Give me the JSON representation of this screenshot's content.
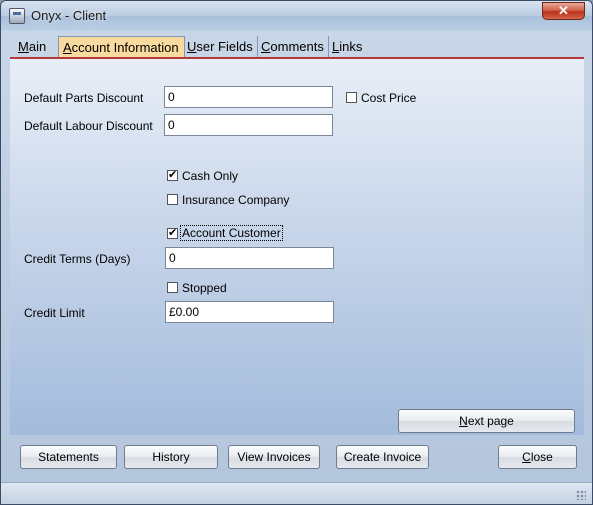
{
  "window": {
    "title": "Onyx - Client",
    "close_symbol": "✕"
  },
  "tabs": [
    {
      "pre": "",
      "u": "M",
      "post": "ain"
    },
    {
      "pre": "",
      "u": "A",
      "post": "ccount Information"
    },
    {
      "pre": "",
      "u": "U",
      "post": "ser Fields"
    },
    {
      "pre": "",
      "u": "C",
      "post": "omments"
    },
    {
      "pre": "",
      "u": "L",
      "post": "inks"
    }
  ],
  "form": {
    "parts_discount_label": "Default Parts Discount",
    "parts_discount_value": "0",
    "cost_price_label": "Cost Price",
    "labour_discount_label": "Default Labour Discount",
    "labour_discount_value": "0",
    "cash_only_label": "Cash Only",
    "insurance_label": "Insurance Company",
    "account_customer_label": "Account Customer",
    "credit_terms_label": "Credit Terms (Days)",
    "credit_terms_value": "0",
    "stopped_label": "Stopped",
    "credit_limit_label": "Credit Limit",
    "credit_limit_value": "£0.00"
  },
  "buttons": {
    "next_page_pre": "",
    "next_page_u": "N",
    "next_page_post": "ext page",
    "statements": "Statements",
    "history": "History",
    "view_invoices": "View Invoices",
    "create_invoice": "Create Invoice",
    "close_pre": "",
    "close_u": "C",
    "close_post": "lose"
  }
}
